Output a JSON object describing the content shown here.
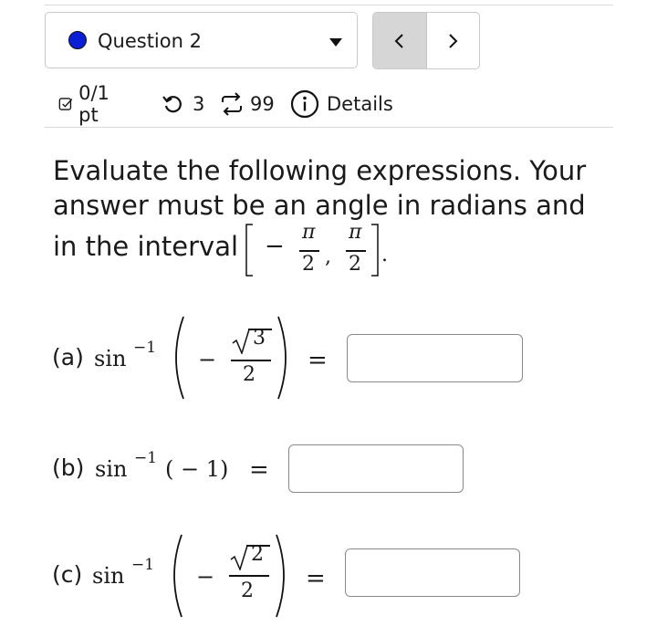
{
  "question_selector": {
    "label": "Question 2",
    "dot_color": "#0b1fd6"
  },
  "nav": {
    "prev_icon": "chevron-left-icon",
    "next_icon": "chevron-right-icon"
  },
  "meta": {
    "score": "0/1 pt",
    "retries": "3",
    "submissions": "99",
    "details": "Details"
  },
  "question": {
    "line1": "Evaluate the following expressions. Your",
    "line2": "answer must be an angle in radians and",
    "line3": "in the interval",
    "interval_minus": "−",
    "pi": "π",
    "two": "2",
    "comma": ",",
    "period": "."
  },
  "parts": {
    "a": {
      "label": "(a)",
      "func": "sin",
      "exp": "−1",
      "minus": "−",
      "sqrt_arg": "3",
      "den": "2",
      "equals": "="
    },
    "b": {
      "label": "(b)",
      "func": "sin",
      "exp": "−1",
      "arg": "( − 1)",
      "equals": "="
    },
    "c": {
      "label": "(c)",
      "func": "sin",
      "exp": "−1",
      "minus": "−",
      "sqrt_arg": "2",
      "den": "2",
      "equals": "="
    }
  }
}
